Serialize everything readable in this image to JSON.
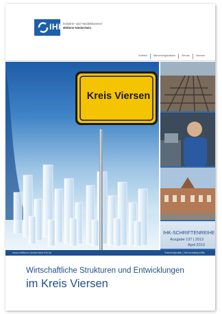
{
  "header": {
    "logo_text": "IHK",
    "org_line1": "Industrie- und Handelskammer",
    "org_line2": "Mittlerer Niederrhein"
  },
  "nav": {
    "items": [
      "Krefeld",
      "Mönchengladbach",
      "Neuss",
      "Viersen"
    ]
  },
  "sign": {
    "text": "Kreis Viersen",
    "color": "#f5c400"
  },
  "series_box": {
    "label": "IHK-SCHRIFTENREIHE",
    "issue": "Ausgabe 137 | 2013",
    "date": "April 2013"
  },
  "footer_bar": {
    "url": "www.mittlerer-niederrhein.ihk.de",
    "category": "Standortpolitik | Wirtschaftspolitik"
  },
  "title": {
    "line1": "Wirtschaftliche Strukturen und Entwicklungen",
    "line2": "im Kreis Viersen"
  },
  "colors": {
    "brand_blue": "#1f5ea8",
    "title_blue": "#1f4f8a",
    "sign_yellow": "#f5c400"
  }
}
